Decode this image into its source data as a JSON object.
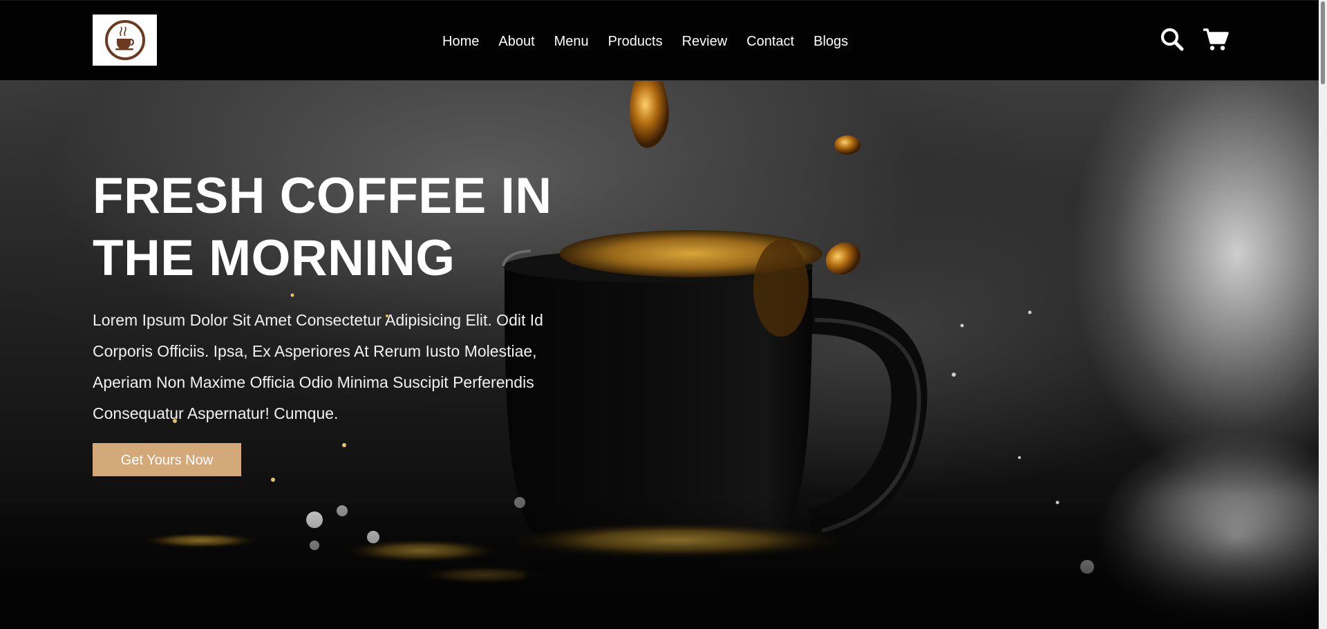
{
  "header": {
    "logo_alt": "coffee cup logo",
    "nav": [
      {
        "label": "Home"
      },
      {
        "label": "About"
      },
      {
        "label": "Menu"
      },
      {
        "label": "Products"
      },
      {
        "label": "Review"
      },
      {
        "label": "Contact"
      },
      {
        "label": "Blogs"
      }
    ],
    "icons": [
      "search-icon",
      "cart-icon"
    ]
  },
  "hero": {
    "title": "FRESH COFFEE IN THE MORNING",
    "text": "Lorem Ipsum Dolor Sit Amet Consectetur Adipisicing Elit. Odit Id Corporis Officiis. Ipsa, Ex Asperiores At Rerum Iusto Molestiae, Aperiam Non Maxime Officia Odio Minima Suscipit Perferendis Consequatur Aspernatur! Cumque.",
    "button_label": "Get Yours Now"
  },
  "colors": {
    "header_bg": "#020202",
    "accent": "#d3a97a",
    "logo_brown": "#6b3a1f",
    "text": "#ffffff"
  }
}
